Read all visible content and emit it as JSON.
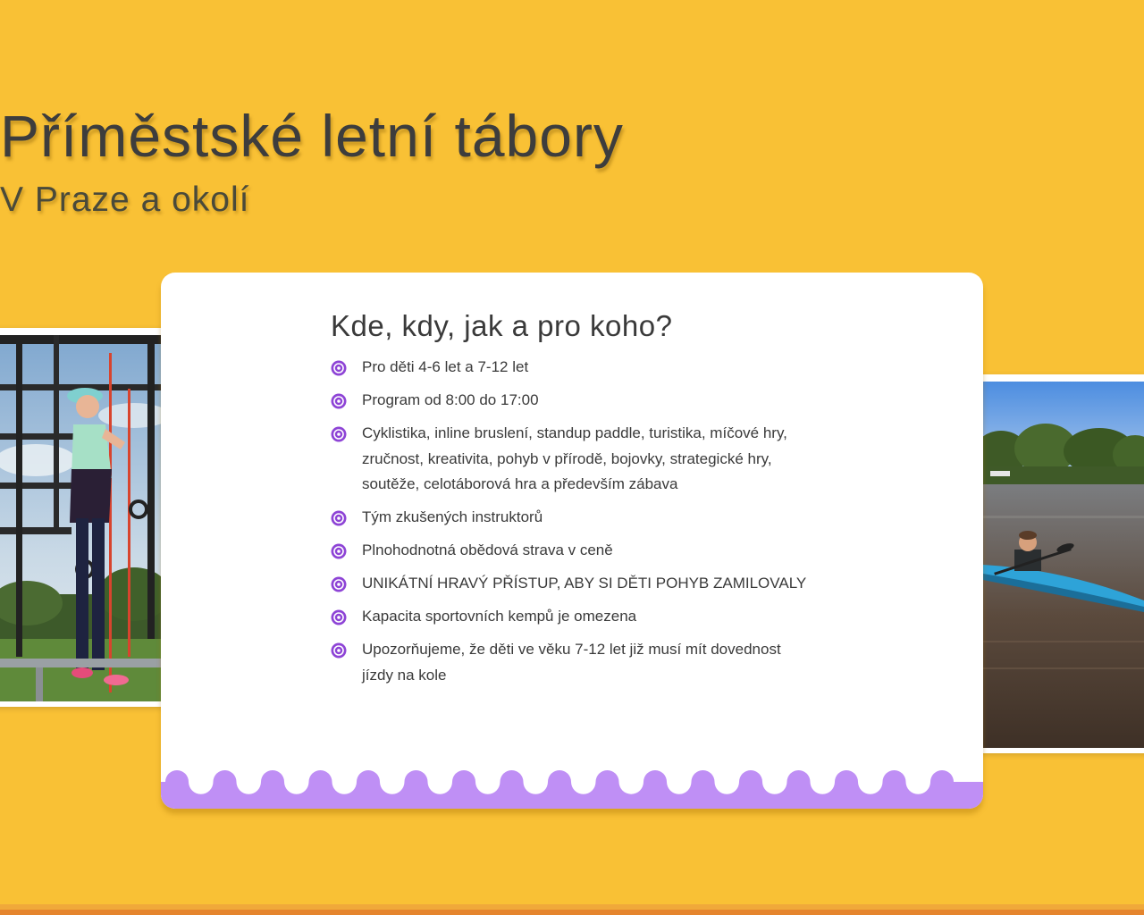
{
  "header": {
    "title": "Příměstské letní tábory",
    "subtitle": "V Praze a okolí"
  },
  "card": {
    "heading": "Kde, kdy, jak a pro koho?",
    "bullet_icon": "purple-flower-icon",
    "items": [
      "Pro děti 4-6 let a 7-12 let",
      "Program od 8:00 do 17:00",
      "Cyklistika, inline bruslení, standup paddle, turistika, míčové hry, zručnost, kreativita, pohyb v přírodě, bojovky, strategické hry, soutěže, celotáborová hra a především zábava",
      "Tým zkušených instruktorů",
      "Plnohodnotná obědová strava v ceně",
      "UNIKÁTNÍ HRAVÝ PŘÍSTUP, ABY SI DĚTI POHYB ZAMILOVALY",
      "Kapacita sportovních kempů je omezena",
      "Upozorňujeme, že děti ve věku 7-12 let již musí mít dovednost jízdy na kole"
    ]
  },
  "colors": {
    "background": "#f9c135",
    "card": "#ffffff",
    "accent_purple": "#bf8ff5",
    "bullet_purple": "#8e44d6",
    "text": "#3a3a3a",
    "bottom_bar": "#e5852e"
  }
}
